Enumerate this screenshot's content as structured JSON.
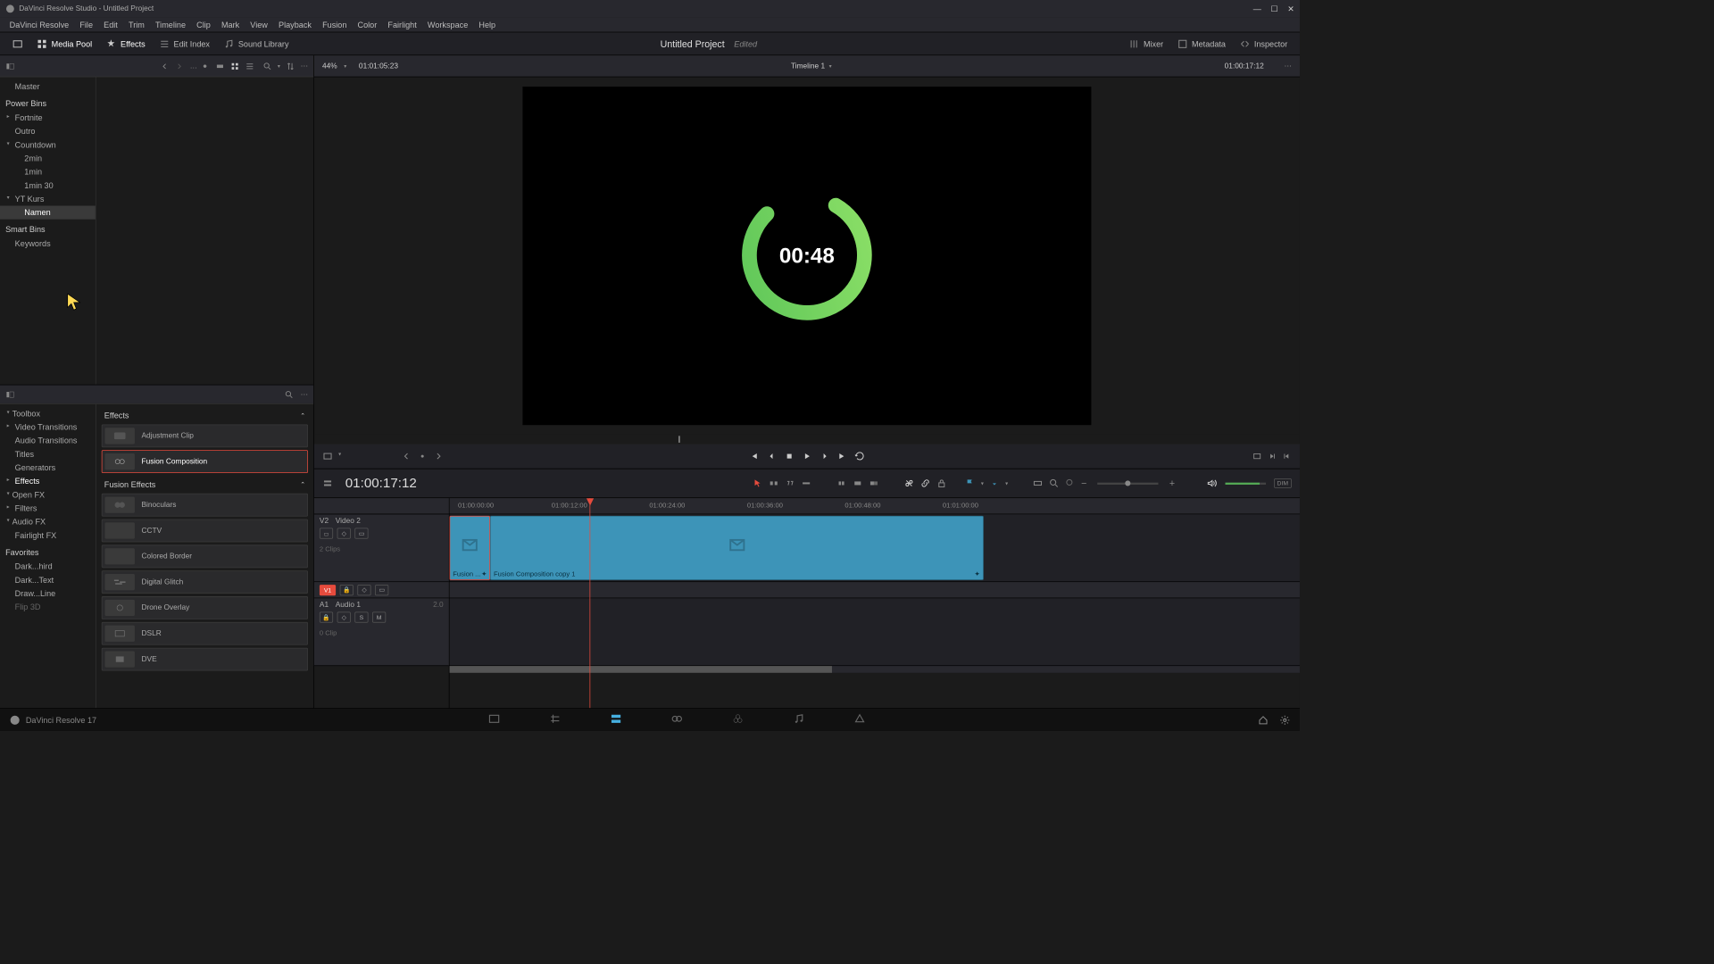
{
  "app": {
    "title": "DaVinci Resolve Studio - Untitled Project"
  },
  "menu": [
    "DaVinci Resolve",
    "File",
    "Edit",
    "Trim",
    "Timeline",
    "Clip",
    "Mark",
    "View",
    "Playback",
    "Fusion",
    "Color",
    "Fairlight",
    "Workspace",
    "Help"
  ],
  "toolbar": {
    "media_pool": "Media Pool",
    "effects": "Effects",
    "edit_index": "Edit Index",
    "sound_library": "Sound Library",
    "mixer": "Mixer",
    "metadata": "Metadata",
    "inspector": "Inspector",
    "project": "Untitled Project",
    "status": "Edited"
  },
  "viewer_top": {
    "zoom": "44%",
    "tc_left": "01:01:05:23",
    "timeline_name": "Timeline 1",
    "tc_right": "01:00:17:12"
  },
  "bins": {
    "master": "Master",
    "power": "Power Bins",
    "items": [
      "Fortnite",
      "Outro",
      "Countdown",
      "2min",
      "1min",
      "1min 30",
      "YT Kurs",
      "Namen"
    ],
    "smart": "Smart Bins",
    "keywords": "Keywords"
  },
  "fx_tree": {
    "toolbox": "Toolbox",
    "video_transitions": "Video Transitions",
    "audio_transitions": "Audio Transitions",
    "titles": "Titles",
    "generators": "Generators",
    "effects": "Effects",
    "openfx": "Open FX",
    "filters": "Filters",
    "audiofx": "Audio FX",
    "fairlightfx": "Fairlight FX",
    "favorites": "Favorites",
    "fav_items": [
      "Dark...hird",
      "Dark...Text",
      "Draw...Line",
      "Flip 3D"
    ]
  },
  "fx_list": {
    "header_effects": "Effects",
    "adjustment": "Adjustment Clip",
    "fusion_comp": "Fusion Composition",
    "header_fusion": "Fusion Effects",
    "items": [
      "Binoculars",
      "CCTV",
      "Colored Border",
      "Digital Glitch",
      "Drone Overlay",
      "DSLR",
      "DVE"
    ]
  },
  "countdown": "00:48",
  "tl_tc": "01:00:17:12",
  "ruler": [
    "01:00:00:00",
    "01:00:12:00",
    "01:00:24:00",
    "01:00:36:00",
    "01:00:48:00",
    "01:01:00:00"
  ],
  "tracks": {
    "v2_id": "V2",
    "v2_name": "Video 2",
    "v1_id": "V1",
    "a1_id": "A1",
    "a1_name": "Audio 1",
    "a1_ch": "2.0",
    "clips_label": "2 Clips",
    "a_clips_label": "0 Clip",
    "clip1": "Fusion ...",
    "clip2": "Fusion Composition copy 1"
  },
  "footer": "DaVinci Resolve 17"
}
